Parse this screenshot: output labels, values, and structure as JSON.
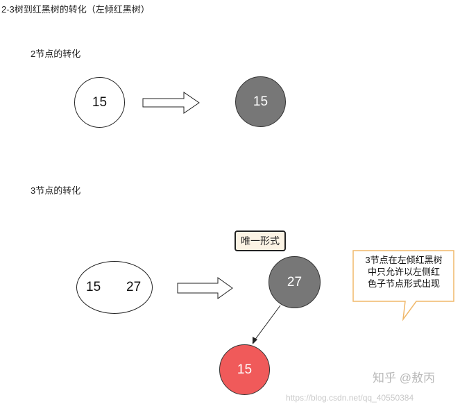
{
  "title": "2-3树到红黑树的转化（左倾红黑树）",
  "section_2node": {
    "label": "2节点的转化",
    "before": {
      "key": "15"
    },
    "after": {
      "key": "15",
      "color": "black"
    }
  },
  "section_3node": {
    "label": "3节点的转化",
    "before": {
      "keys": [
        "15",
        "27"
      ]
    },
    "after": {
      "unique_label": "唯一形式",
      "parent": {
        "key": "27",
        "color": "black"
      },
      "left_child": {
        "key": "15",
        "color": "red"
      }
    }
  },
  "callout": {
    "lines": [
      "3节点在左倾红黑树",
      "中只允许以左侧红",
      "色子节点形式出现"
    ]
  },
  "watermark": "知乎 @敖丙",
  "url": "https://blog.csdn.net/qq_40550384",
  "colors": {
    "black_node": "#777777",
    "red_node": "#f05a5a",
    "callout_border": "#f0b86a",
    "note_bg": "#fbf3e4"
  }
}
